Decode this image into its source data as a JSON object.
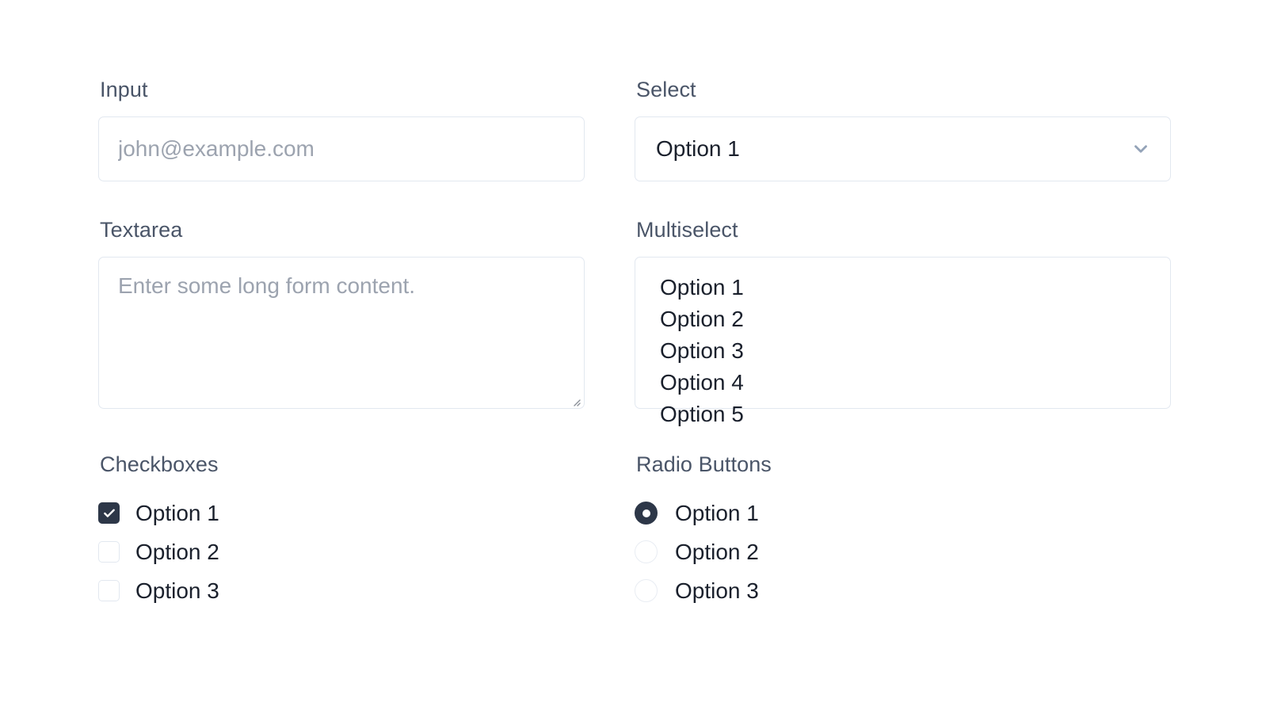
{
  "form": {
    "input": {
      "label": "Input",
      "placeholder": "john@example.com",
      "value": ""
    },
    "textarea": {
      "label": "Textarea",
      "placeholder": "Enter some long form content.",
      "value": ""
    },
    "select": {
      "label": "Select",
      "selected": "Option 1",
      "icon": "chevron-down-icon",
      "options": [
        "Option 1"
      ]
    },
    "multiselect": {
      "label": "Multiselect",
      "options": [
        "Option 1",
        "Option 2",
        "Option 3",
        "Option 4",
        "Option 5"
      ]
    },
    "checkboxes": {
      "label": "Checkboxes",
      "items": [
        {
          "label": "Option 1",
          "checked": true
        },
        {
          "label": "Option 2",
          "checked": false
        },
        {
          "label": "Option 3",
          "checked": false
        }
      ]
    },
    "radios": {
      "label": "Radio Buttons",
      "items": [
        {
          "label": "Option 1",
          "selected": true
        },
        {
          "label": "Option 2",
          "selected": false
        },
        {
          "label": "Option 3",
          "selected": false
        }
      ]
    }
  },
  "colors": {
    "label": "#4a5568",
    "text": "#1a202c",
    "placeholder": "#9ca3af",
    "border": "#e2e8f0",
    "accent": "#2d3748",
    "chevron": "#94a3b8",
    "background": "#ffffff"
  }
}
